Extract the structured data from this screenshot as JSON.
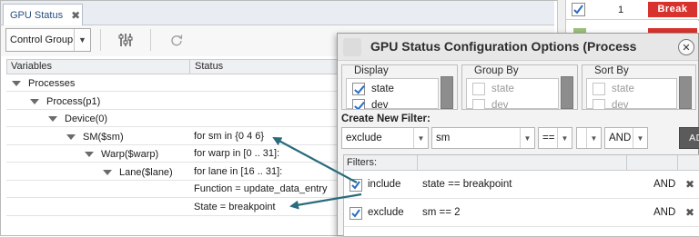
{
  "tab": {
    "label": "GPU Status",
    "close": "✖"
  },
  "toolbar": {
    "control_group": "Control Group"
  },
  "tree": {
    "headers": [
      "Variables",
      "Status"
    ],
    "rows": [
      {
        "label": "Processes",
        "status": ""
      },
      {
        "label": "Process(p1)",
        "status": ""
      },
      {
        "label": "Device(0)",
        "status": ""
      },
      {
        "label": "SM($sm)",
        "status": "for sm in {0 4 6}"
      },
      {
        "label": "Warp($warp)",
        "status": "for warp in [0 .. 31]:"
      },
      {
        "label": "Lane($lane)",
        "status": "for lane in [16 .. 31]:"
      },
      {
        "label": "",
        "status": "Function = update_data_entry"
      },
      {
        "label": "",
        "status": "State = breakpoint"
      }
    ]
  },
  "breakpoints": {
    "number": "1",
    "action": "Break"
  },
  "dialog": {
    "title": "GPU Status Configuration Options (Process",
    "groups": {
      "display": {
        "legend": "Display",
        "items": [
          "state",
          "dev"
        ]
      },
      "group_by": {
        "legend": "Group By",
        "items": [
          "state",
          "dev"
        ]
      },
      "sort_by": {
        "legend": "Sort By",
        "items": [
          "state",
          "dev"
        ]
      }
    },
    "create_filter": {
      "heading": "Create New Filter:",
      "action": "exclude",
      "field": "sm",
      "operator": "==",
      "value": "",
      "conjunction": "AND",
      "add_label": "ADD"
    },
    "filters": {
      "heading": "Filters:",
      "rows": [
        {
          "action": "include",
          "expr": "state == breakpoint",
          "op": "AND",
          "del": "✖"
        },
        {
          "action": "exclude",
          "expr": "sm == 2",
          "op": "AND",
          "del": "✖"
        }
      ]
    }
  },
  "colors": {
    "accent": "#2b6cc4",
    "break": "#d8322e",
    "arrow": "#2a6b7c"
  }
}
